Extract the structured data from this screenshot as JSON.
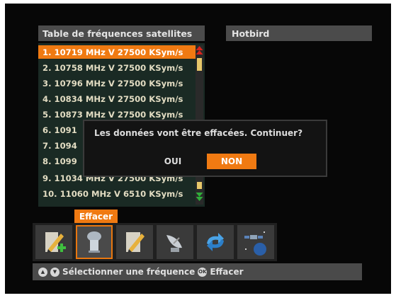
{
  "list": {
    "title": "Table de fréquences satellites",
    "items": [
      "1. 10719 MHz V 27500 KSym/s",
      "2. 10758 MHz V 27500 KSym/s",
      "3. 10796 MHz V 27500 KSym/s",
      "4. 10834 MHz V 27500 KSym/s",
      "5. 10873 MHz V 27500 KSym/s",
      "6. 1091",
      "7. 1094",
      "8. 1099",
      "9. 11034 MHz V 27500 KSym/s",
      "10. 11060 MHz V 6510 KSym/s"
    ],
    "selected_index": 0
  },
  "satellite": {
    "name": "Hotbird"
  },
  "dialog": {
    "message": "Les données vont être effacées. Continuer?",
    "yes_label": "OUI",
    "no_label": "NON",
    "focused": "NON"
  },
  "toolbar": {
    "tooltip": "Effacer",
    "tools": [
      {
        "icon": "edit-add-icon"
      },
      {
        "icon": "delete-icon",
        "selected": true
      },
      {
        "icon": "edit-icon"
      },
      {
        "icon": "satellite-dish-icon"
      },
      {
        "icon": "refresh-arrows-icon"
      },
      {
        "icon": "satellite-earth-icon"
      }
    ]
  },
  "status": {
    "select_text": "Sélectionner une fréquence",
    "ok_key": "OK",
    "action_text": "Effacer"
  },
  "colors": {
    "accent": "#f07a12",
    "list_bg": "#1a2a24",
    "header_bg": "#4b4b4b"
  }
}
